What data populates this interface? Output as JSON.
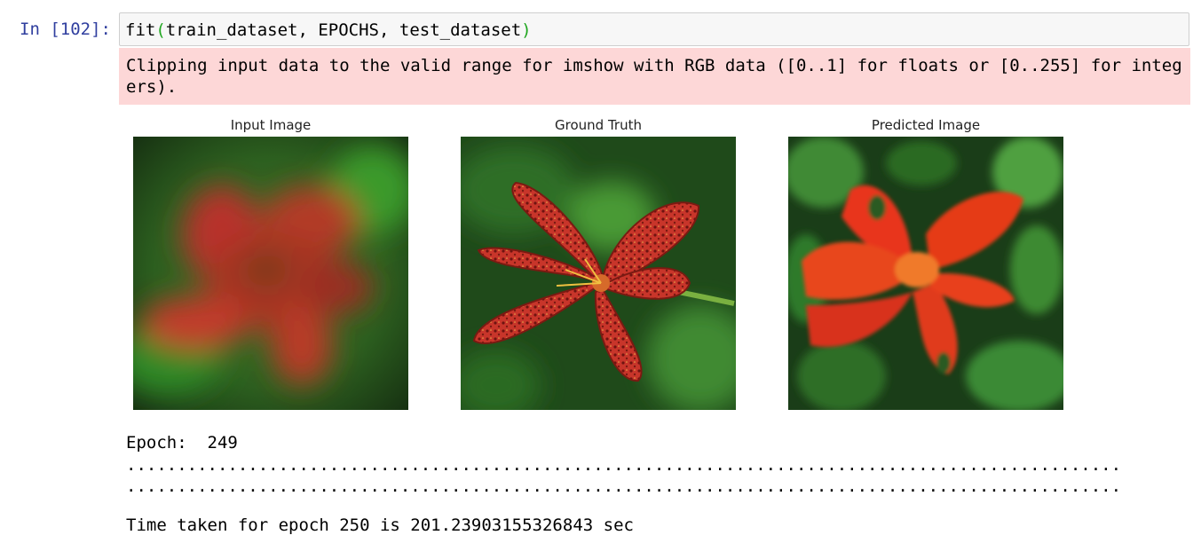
{
  "cell": {
    "prompt": "In [102]:",
    "code": {
      "func": "fit",
      "open_paren": "(",
      "args": "train_dataset, EPOCHS, test_dataset",
      "close_paren": ")"
    }
  },
  "stderr": {
    "text": "Clipping input data to the valid range for imshow with RGB data ([0..1] for floats or [0..255] for integers)."
  },
  "figures": [
    {
      "title": "Input Image"
    },
    {
      "title": "Ground Truth"
    },
    {
      "title": "Predicted Image"
    }
  ],
  "stdout": {
    "epoch_line": "Epoch:  249",
    "dots_line_1": "..................................................................................................",
    "dots_line_2": "..................................................................................................",
    "time_line": "Time taken for epoch 250 is 201.23903155326843 sec"
  },
  "colors": {
    "prompt": "#303f9f",
    "stderr_bg": "#fdd7d7",
    "cell_bg": "#f7f7f7",
    "paren": "#1fa61f"
  },
  "icons": [
    "blurred-flower-image",
    "red-lily-flower-image",
    "predicted-flower-image"
  ]
}
